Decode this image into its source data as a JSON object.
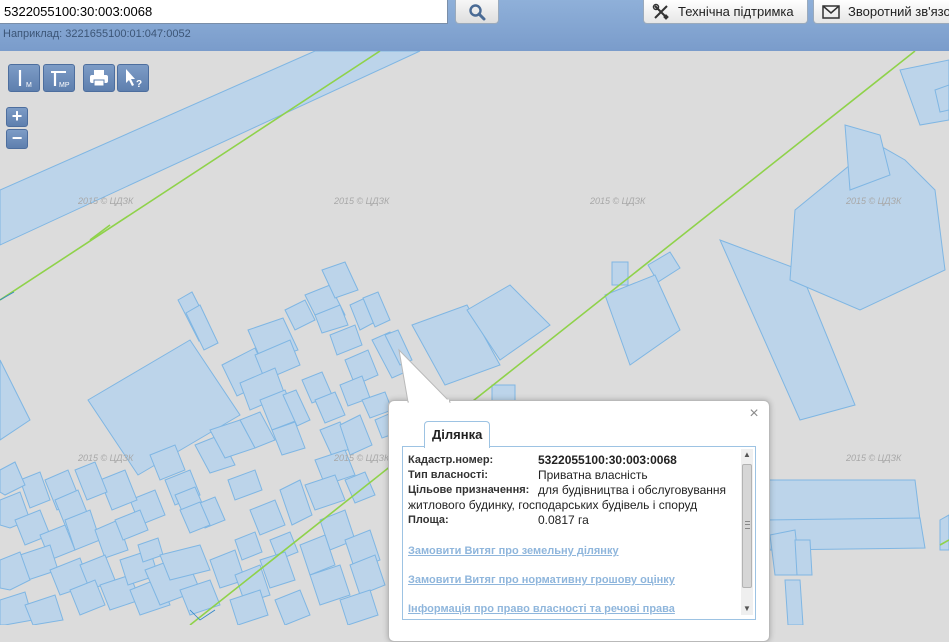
{
  "search": {
    "value": "5322055100:30:003:0068",
    "hint": "Наприклад: 3221655100:01:047:0052"
  },
  "header": {
    "support_label": "Технічна підтримка",
    "feedback_label": "Зворотний зв'язо"
  },
  "map": {
    "watermark": "2015 © ЦДЗК",
    "zoom_in": "+",
    "zoom_out": "−",
    "tools": [
      "measure-distance",
      "measure-area",
      "print",
      "identify"
    ],
    "tool_marks": {
      "distance": "М",
      "area": "МР",
      "identify": "?"
    }
  },
  "popup": {
    "tab": "Ділянка",
    "close": "×",
    "cadastral_label": "Кадастр.номер:",
    "cadastral_value": "5322055100:30:003:0068",
    "ownership_label": "Тип власності:",
    "ownership_value": "Приватна власність",
    "purpose_label": "Цільове призначення:",
    "purpose_value": "для будівництва і обслуговування",
    "purpose_value_cont": "житлового будинку, господарських будівель і споруд",
    "area_label": "Площа:",
    "area_value": "0.0817 га",
    "links": [
      "Замовити Витяг про земельну ділянку",
      "Замовити Витяг про нормативну грошову оцінку",
      "Інформація про право власності та речові права"
    ]
  },
  "colors": {
    "parcel_fill": "#bcd4ea",
    "parcel_stroke": "#7fb6e3",
    "boundary": "#8fd24a",
    "background": "#dcdcdc"
  }
}
